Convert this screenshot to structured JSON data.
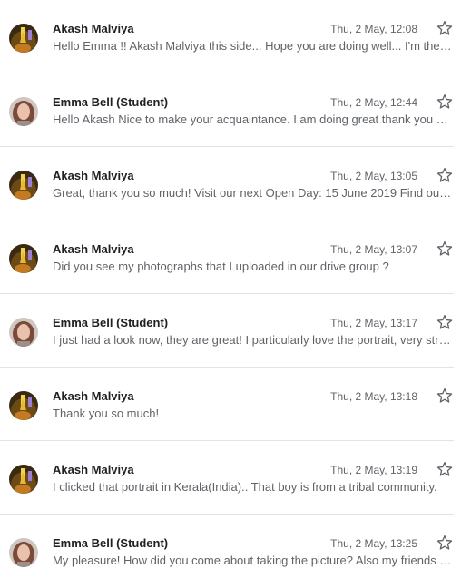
{
  "messages": [
    {
      "sender": "Akash Malviya",
      "time": "Thu, 2 May, 12:08",
      "snippet": "Hello Emma !! Akash Malviya this side... Hope you are doing well... I'm the volunteer for the Open Day",
      "avatar": "akash"
    },
    {
      "sender": "Emma Bell (Student)",
      "time": "Thu, 2 May, 12:44",
      "snippet": "Hello Akash Nice to make your acquaintance. I am doing great thank you and hope you are too",
      "avatar": "emma"
    },
    {
      "sender": "Akash Malviya",
      "time": "Thu, 2 May, 13:05",
      "snippet": "Great, thank you so much! Visit our next Open Day: 15 June 2019 Find out more about the day",
      "avatar": "akash"
    },
    {
      "sender": "Akash Malviya",
      "time": "Thu, 2 May, 13:07",
      "snippet": "Did you see my photographs that I uploaded in our drive group ?",
      "avatar": "akash"
    },
    {
      "sender": "Emma Bell (Student)",
      "time": "Thu, 2 May, 13:17",
      "snippet": "I just had a look now, they are great! I particularly love the portrait, very striking image",
      "avatar": "emma"
    },
    {
      "sender": "Akash Malviya",
      "time": "Thu, 2 May, 13:18",
      "snippet": "Thank you so much!",
      "avatar": "akash"
    },
    {
      "sender": "Akash Malviya",
      "time": "Thu, 2 May, 13:19",
      "snippet": "I clicked that portrait in Kerala(India).. That boy is from a tribal community.",
      "avatar": "akash"
    },
    {
      "sender": "Emma Bell (Student)",
      "time": "Thu, 2 May, 13:25",
      "snippet": "My pleasure! How did you come about taking the picture? Also my friends would love to see it",
      "avatar": "emma"
    }
  ],
  "icons": {
    "star": "star-outline-icon"
  },
  "colors": {
    "sender_text": "#202124",
    "secondary_text": "#5f6368",
    "divider": "#e3e3e3",
    "star_outline": "#5f6368"
  }
}
